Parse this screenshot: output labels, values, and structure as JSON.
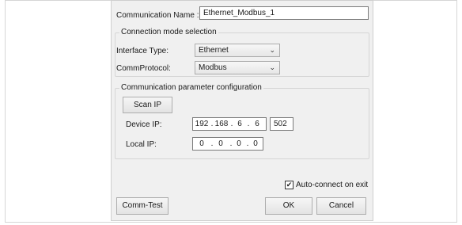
{
  "dialog": {
    "comm_name_label": "Communication Name :",
    "comm_name_value": "Ethernet_Modbus_1",
    "connection_group_title": "Connection mode selection",
    "interface_type_label": "Interface Type:",
    "interface_type_value": "Ethernet",
    "comm_protocol_label": "CommProtocol:",
    "comm_protocol_value": "Modbus",
    "param_group_title": "Communication parameter configuration",
    "scan_ip_label": "Scan IP",
    "device_ip_label": "Device IP:",
    "device_ip": [
      "192",
      "168",
      "6",
      "6"
    ],
    "device_port": "502",
    "local_ip_label": "Local IP:",
    "local_ip": [
      "0",
      "0",
      "0",
      "0"
    ],
    "auto_connect_label": "Auto-connect on exit",
    "auto_connect_checked": true,
    "comm_test_label": "Comm-Test",
    "ok_label": "OK",
    "cancel_label": "Cancel",
    "chevron_glyph": "⌄",
    "checkmark_glyph": "✔",
    "ip_separator": "."
  }
}
